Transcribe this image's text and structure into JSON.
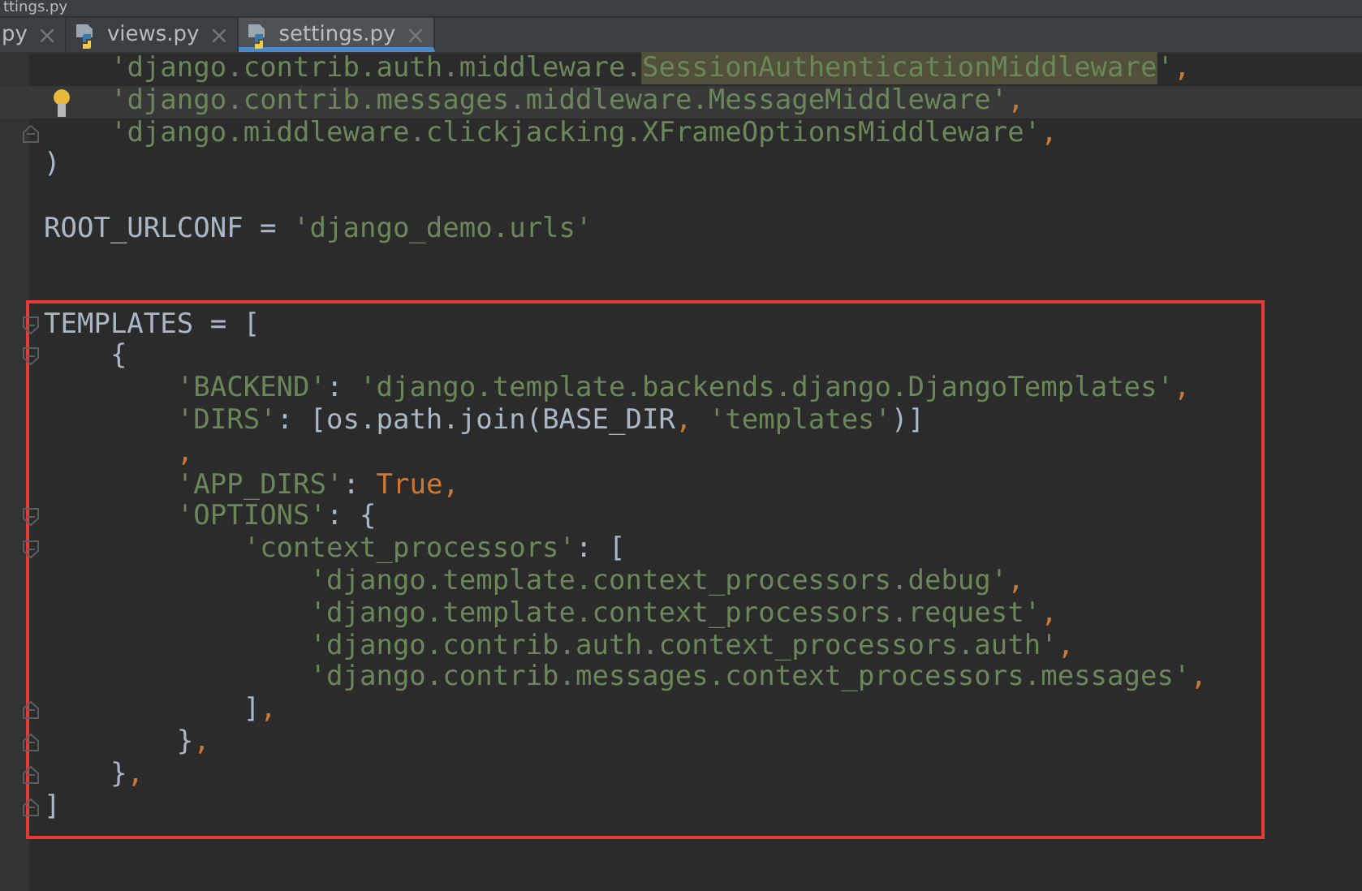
{
  "window": {
    "title": "ttings.py"
  },
  "tabs": [
    {
      "label": "py",
      "selected": false,
      "python_icon": false
    },
    {
      "label": "views.py",
      "selected": false,
      "python_icon": true
    },
    {
      "label": "settings.py",
      "selected": true,
      "python_icon": true
    }
  ],
  "sections": [
    {
      "outlined": false,
      "lines": [
        {
          "current": false,
          "kind": "plain",
          "tokens": [
            {
              "kind": "str",
              "text": "    'django.contrib.auth.middleware."
            },
            {
              "kind": "hl",
              "text": "SessionAuthenticationMiddleware"
            },
            {
              "kind": "str",
              "text": "'"
            },
            {
              "kind": "kw",
              "text": ","
            }
          ]
        },
        {
          "current": true,
          "kind": "bulb",
          "tokens": [
            {
              "kind": "str",
              "text": "    'django.contrib.messages.middleware.MessageMiddleware'"
            },
            {
              "kind": "kw",
              "text": ","
            }
          ]
        },
        {
          "current": false,
          "kind": "fold_end",
          "tokens": [
            {
              "kind": "str",
              "text": "    'django.middleware.clickjacking.XFrameOptionsMiddleware'"
            },
            {
              "kind": "kw",
              "text": ","
            }
          ]
        },
        {
          "current": false,
          "kind": "plain",
          "tokens": [
            {
              "kind": "plain",
              "text": ")"
            }
          ]
        },
        {
          "current": false,
          "kind": "plain"
        },
        {
          "current": false,
          "kind": "plain",
          "tokens": [
            {
              "kind": "plain",
              "text": "ROOT_URLCONF = "
            },
            {
              "kind": "str",
              "text": "'django_demo.urls'"
            }
          ]
        },
        {
          "current": false,
          "kind": "plain"
        }
      ]
    },
    {
      "outlined": true,
      "lines": [
        {
          "current": false,
          "kind": "fold_start",
          "tokens": [
            {
              "kind": "plain",
              "text": "TEMPLATES = ["
            }
          ]
        },
        {
          "current": false,
          "kind": "fold_start",
          "tokens": [
            {
              "kind": "plain",
              "text": "    {"
            }
          ]
        },
        {
          "current": false,
          "kind": "plain",
          "tokens": [
            {
              "kind": "str",
              "text": "        'BACKEND'"
            },
            {
              "kind": "plain",
              "text": ": "
            },
            {
              "kind": "str",
              "text": "'django.template.backends.django.DjangoTemplates'"
            },
            {
              "kind": "kw",
              "text": ","
            }
          ]
        },
        {
          "current": false,
          "kind": "plain",
          "tokens": [
            {
              "kind": "str",
              "text": "        'DIRS'"
            },
            {
              "kind": "plain",
              "text": ": [os.path.join(BASE_DIR"
            },
            {
              "kind": "kw",
              "text": ", "
            },
            {
              "kind": "str",
              "text": "'templates'"
            },
            {
              "kind": "plain",
              "text": ")]"
            }
          ]
        },
        {
          "current": false,
          "kind": "plain",
          "tokens": [
            {
              "kind": "kw",
              "text": "        ,"
            }
          ]
        },
        {
          "current": false,
          "kind": "plain",
          "tokens": [
            {
              "kind": "str",
              "text": "        'APP_DIRS'"
            },
            {
              "kind": "plain",
              "text": ": "
            },
            {
              "kind": "kw",
              "text": "True,"
            }
          ]
        },
        {
          "current": false,
          "kind": "fold_start",
          "tokens": [
            {
              "kind": "str",
              "text": "        'OPTIONS'"
            },
            {
              "kind": "plain",
              "text": ": {"
            }
          ]
        },
        {
          "current": false,
          "kind": "fold_start",
          "tokens": [
            {
              "kind": "str",
              "text": "            'context_processors'"
            },
            {
              "kind": "plain",
              "text": ": ["
            }
          ]
        },
        {
          "current": false,
          "kind": "plain",
          "tokens": [
            {
              "kind": "str",
              "text": "                'django.template.context_processors.debug'"
            },
            {
              "kind": "kw",
              "text": ","
            }
          ]
        },
        {
          "current": false,
          "kind": "plain",
          "tokens": [
            {
              "kind": "str",
              "text": "                'django.template.context_processors.request'"
            },
            {
              "kind": "kw",
              "text": ","
            }
          ]
        },
        {
          "current": false,
          "kind": "plain",
          "tokens": [
            {
              "kind": "str",
              "text": "                'django.contrib.auth.context_processors.auth'"
            },
            {
              "kind": "kw",
              "text": ","
            }
          ]
        },
        {
          "current": false,
          "kind": "plain",
          "tokens": [
            {
              "kind": "str",
              "text": "                'django.contrib.messages.context_processors.messages'"
            },
            {
              "kind": "kw",
              "text": ","
            }
          ]
        },
        {
          "current": false,
          "kind": "fold_end",
          "tokens": [
            {
              "kind": "plain",
              "text": "            ]"
            },
            {
              "kind": "kw",
              "text": ","
            }
          ]
        },
        {
          "current": false,
          "kind": "fold_end",
          "tokens": [
            {
              "kind": "plain",
              "text": "        }"
            },
            {
              "kind": "kw",
              "text": ","
            }
          ]
        },
        {
          "current": false,
          "kind": "fold_end",
          "tokens": [
            {
              "kind": "plain",
              "text": "    }"
            },
            {
              "kind": "kw",
              "text": ","
            }
          ]
        },
        {
          "current": false,
          "kind": "fold_end",
          "tokens": [
            {
              "kind": "plain",
              "text": "]"
            }
          ]
        }
      ]
    }
  ]
}
